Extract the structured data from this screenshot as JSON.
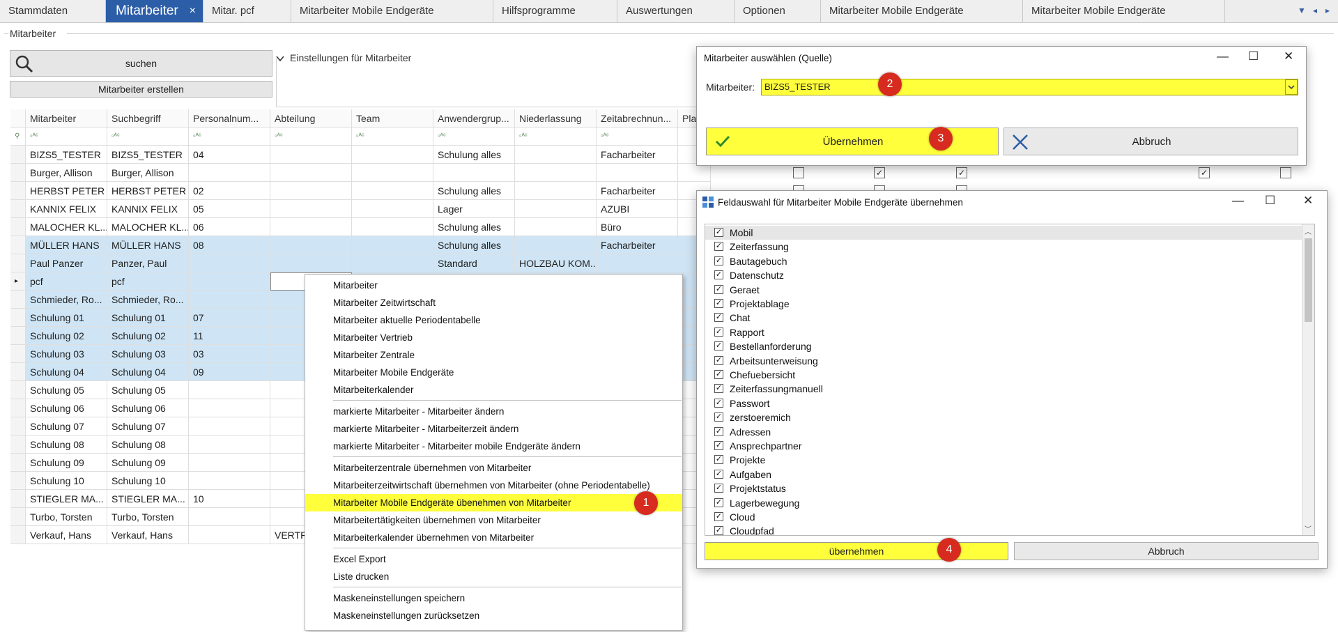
{
  "tabs": [
    {
      "label": "Stammdaten"
    },
    {
      "label": "Mitarbeiter"
    },
    {
      "label": "Mitar. pcf"
    },
    {
      "label": "Mitarbeiter Mobile Endgeräte"
    },
    {
      "label": "Hilfsprogramme"
    },
    {
      "label": "Auswertungen"
    },
    {
      "label": "Optionen"
    },
    {
      "label": "Mitarbeiter Mobile Endgeräte"
    },
    {
      "label": "Mitarbeiter Mobile Endgeräte"
    }
  ],
  "tab_close": "×",
  "tab_nav": {
    "down": "▼",
    "left": "◂",
    "right": "▸"
  },
  "group_caption": "Mitarbeiter",
  "search_button": "suchen",
  "create_button": "Mitarbeiter erstellen",
  "settings_label": "Einstellungen für Mitarbeiter",
  "grid": {
    "columns": [
      "Mitarbeiter",
      "Suchbegriff",
      "Personalnum...",
      "Abteilung",
      "Team",
      "Anwendergrup...",
      "Niederlassung",
      "Zeitabrechnun...",
      "Pla"
    ],
    "filter_icon": "▫ᴬᶜ",
    "rows": [
      {
        "name": "BIZS5_TESTER",
        "such": "BIZS5_TESTER",
        "pnr": "04",
        "abt": "",
        "team": "",
        "gruppe": "Schulung alles",
        "nl": "",
        "zeit": "Facharbeiter"
      },
      {
        "name": "Burger, Allison",
        "such": "Burger, Allison",
        "pnr": "",
        "abt": "",
        "team": "",
        "gruppe": "",
        "nl": "",
        "zeit": ""
      },
      {
        "name": "HERBST PETER",
        "such": "HERBST PETER",
        "pnr": "02",
        "abt": "",
        "team": "",
        "gruppe": "Schulung alles",
        "nl": "",
        "zeit": "Facharbeiter"
      },
      {
        "name": "KANNIX FELIX",
        "such": "KANNIX FELIX",
        "pnr": "05",
        "abt": "",
        "team": "",
        "gruppe": "Lager",
        "nl": "",
        "zeit": "AZUBI"
      },
      {
        "name": "MALOCHER KL...",
        "such": "MALOCHER KL...",
        "pnr": "06",
        "abt": "",
        "team": "",
        "gruppe": "Schulung alles",
        "nl": "",
        "zeit": "Büro"
      },
      {
        "name": "MÜLLER HANS",
        "such": "MÜLLER HANS",
        "pnr": "08",
        "abt": "",
        "team": "",
        "gruppe": "Schulung alles",
        "nl": "",
        "zeit": "Facharbeiter"
      },
      {
        "name": "Paul Panzer",
        "such": "Panzer, Paul",
        "pnr": "",
        "abt": "",
        "team": "",
        "gruppe": "Standard",
        "nl": "HOLZBAU KOM...",
        "zeit": ""
      },
      {
        "name": "pcf",
        "such": "pcf",
        "pnr": "",
        "abt": "",
        "team": "",
        "gruppe": "",
        "nl": "",
        "zeit": ""
      },
      {
        "name": "Schmieder, Ro...",
        "such": "Schmieder, Ro...",
        "pnr": "",
        "abt": "",
        "team": "",
        "gruppe": "",
        "nl": "",
        "zeit": ""
      },
      {
        "name": "Schulung 01",
        "such": "Schulung 01",
        "pnr": "07",
        "abt": "",
        "team": "",
        "gruppe": "",
        "nl": "",
        "zeit": ""
      },
      {
        "name": "Schulung 02",
        "such": "Schulung 02",
        "pnr": "11",
        "abt": "",
        "team": "",
        "gruppe": "",
        "nl": "",
        "zeit": ""
      },
      {
        "name": "Schulung 03",
        "such": "Schulung 03",
        "pnr": "03",
        "abt": "",
        "team": "",
        "gruppe": "",
        "nl": "",
        "zeit": ""
      },
      {
        "name": "Schulung 04",
        "such": "Schulung 04",
        "pnr": "09",
        "abt": "",
        "team": "",
        "gruppe": "",
        "nl": "",
        "zeit": ""
      },
      {
        "name": "Schulung 05",
        "such": "Schulung 05",
        "pnr": "",
        "abt": "",
        "team": "",
        "gruppe": "",
        "nl": "",
        "zeit": ""
      },
      {
        "name": "Schulung 06",
        "such": "Schulung 06",
        "pnr": "",
        "abt": "",
        "team": "",
        "gruppe": "",
        "nl": "",
        "zeit": ""
      },
      {
        "name": "Schulung 07",
        "such": "Schulung 07",
        "pnr": "",
        "abt": "",
        "team": "",
        "gruppe": "",
        "nl": "",
        "zeit": ""
      },
      {
        "name": "Schulung 08",
        "such": "Schulung 08",
        "pnr": "",
        "abt": "",
        "team": "",
        "gruppe": "",
        "nl": "",
        "zeit": ""
      },
      {
        "name": "Schulung 09",
        "such": "Schulung 09",
        "pnr": "",
        "abt": "",
        "team": "",
        "gruppe": "",
        "nl": "",
        "zeit": ""
      },
      {
        "name": "Schulung 10",
        "such": "Schulung 10",
        "pnr": "",
        "abt": "",
        "team": "",
        "gruppe": "",
        "nl": "",
        "zeit": ""
      },
      {
        "name": "STIEGLER MA...",
        "such": "STIEGLER MA...",
        "pnr": "10",
        "abt": "",
        "team": "",
        "gruppe": "",
        "nl": "",
        "zeit": ""
      },
      {
        "name": "Turbo, Torsten",
        "such": "Turbo, Torsten",
        "pnr": "",
        "abt": "",
        "team": "",
        "gruppe": "",
        "nl": "",
        "zeit": ""
      },
      {
        "name": "Verkauf, Hans",
        "such": "Verkauf, Hans",
        "pnr": "",
        "abt": "VERTR",
        "team": "",
        "gruppe": "",
        "nl": "",
        "zeit": ""
      }
    ],
    "selected_rows": [
      5,
      6,
      7,
      8,
      9,
      10,
      11,
      12
    ],
    "current_row": 7,
    "row_indicator": "▸"
  },
  "context_menu": {
    "groups": [
      [
        "Mitarbeiter",
        "Mitarbeiter Zeitwirtschaft",
        "Mitarbeiter aktuelle Periodentabelle",
        "Mitarbeiter Vertrieb",
        "Mitarbeiter Zentrale",
        "Mitarbeiter Mobile Endgeräte",
        "Mitarbeiterkalender"
      ],
      [
        "markierte Mitarbeiter - Mitarbeiter ändern",
        "markierte Mitarbeiter - Mitarbeiterzeit ändern",
        "markierte Mitarbeiter - Mitarbeiter mobile Endgeräte ändern"
      ],
      [
        "Mitarbeiterzentrale übernehmen von Mitarbeiter",
        "Mitarbeiterzeitwirtschaft übernehmen von Mitarbeiter (ohne Periodentabelle)",
        "Mitarbeiter Mobile Endgeräte übenehmen von Mitarbeiter",
        "Mitarbeitertätigkeiten übernehmen von Mitarbeiter",
        "Mitarbeiterkalender übernehmen von Mitarbeiter"
      ],
      [
        "Excel Export",
        "Liste drucken"
      ],
      [
        "Maskeneinstellungen speichern",
        "Maskeneinstellungen zurücksetzen"
      ]
    ],
    "highlighted": "Mitarbeiter Mobile Endgeräte übenehmen von Mitarbeiter"
  },
  "source_dialog": {
    "title": "Mitarbeiter auswählen (Quelle)",
    "field_label": "Mitarbeiter:",
    "field_value": "BIZS5_TESTER",
    "ok_label": "Übernehmen",
    "cancel_label": "Abbruch",
    "window_controls": {
      "minimize": "—",
      "maximize": "☐",
      "close": "✕"
    }
  },
  "field_dialog": {
    "title": "Feldauswahl für Mitarbeiter Mobile Endgeräte übernehmen",
    "items": [
      "Mobil",
      "Zeiterfassung",
      "Bautagebuch",
      "Datenschutz",
      "Geraet",
      "Projektablage",
      "Chat",
      "Rapport",
      "Bestellanforderung",
      "Arbeitsunterweisung",
      "Chefuebersicht",
      "Zeiterfassungmanuell",
      "Passwort",
      "zerstoeremich",
      "Adressen",
      "Ansprechpartner",
      "Projekte",
      "Aufgaben",
      "Projektstatus",
      "Lagerbewegung",
      "Cloud",
      "Cloudpfad"
    ],
    "check_mark": "✓",
    "ok_label": "übernehmen",
    "cancel_label": "Abbruch",
    "window_controls": {
      "minimize": "—",
      "maximize": "☐",
      "close": "✕"
    }
  },
  "background_checkboxes": {
    "row_burger": [
      false,
      true,
      true,
      true,
      false
    ],
    "row_herbst": [
      false,
      false,
      false
    ]
  },
  "callouts": [
    "1",
    "2",
    "3",
    "4"
  ],
  "colors": {
    "tab_active": "#2c5ea8",
    "highlight": "#ffff3c",
    "selection": "#cfe5f5",
    "callout": "#d62b1e"
  }
}
